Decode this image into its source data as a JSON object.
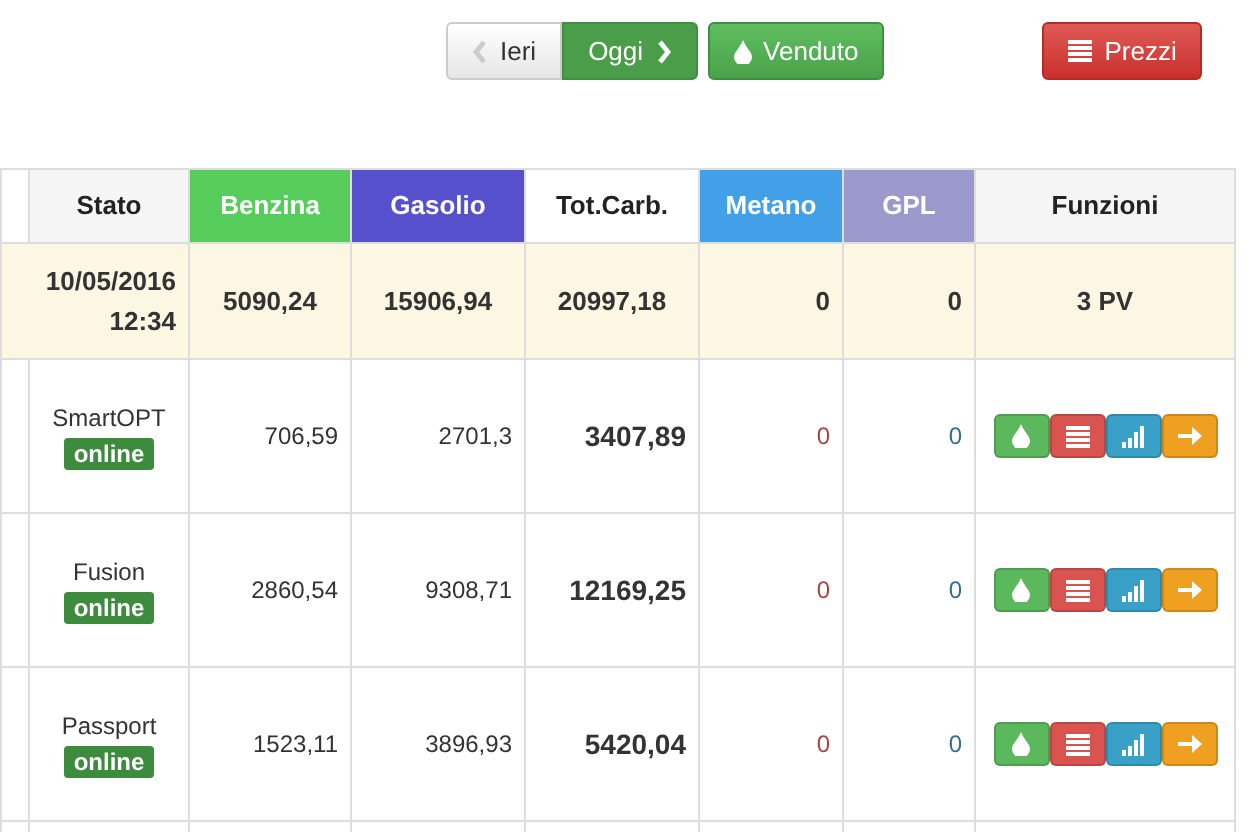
{
  "toolbar": {
    "day_buttons": [
      {
        "label": "Ieri",
        "selected": false,
        "kind": "prev"
      },
      {
        "label": "Oggi",
        "selected": true,
        "kind": "next"
      }
    ],
    "sold_button": "Venduto",
    "prices_button": "Prezzi"
  },
  "table": {
    "columns": [
      {
        "label": "Stato",
        "color": "#f5f5f5"
      },
      {
        "label": "Benzina",
        "color": "#56cc5a"
      },
      {
        "label": "Gasolio",
        "color": "#5650cc"
      },
      {
        "label": "Tot.Carb.",
        "color": "#ffffff"
      },
      {
        "label": "Metano",
        "color": "#42a0e8"
      },
      {
        "label": "GPL",
        "color": "#9b98cc"
      },
      {
        "label": "Funzioni",
        "color": "#f5f5f5"
      }
    ],
    "summary": {
      "timestamp": "10/05/2016 12:34",
      "benzina": "5090,24",
      "gasolio": "15906,94",
      "total": "20997,18",
      "metano": "0",
      "gpl": "0",
      "functions": "3 PV"
    },
    "row_actions": [
      {
        "kind": "drop"
      },
      {
        "kind": "list"
      },
      {
        "kind": "signal"
      },
      {
        "kind": "arrow"
      }
    ],
    "rows": [
      {
        "system": "SmartOPT",
        "status": "online",
        "benzina": "706,59",
        "gasolio": "2701,3",
        "total": "3407,89",
        "metano": "0",
        "gpl": "0"
      },
      {
        "system": "Fusion",
        "status": "online",
        "benzina": "2860,54",
        "gasolio": "9308,71",
        "total": "12169,25",
        "metano": "0",
        "gpl": "0"
      },
      {
        "system": "Passport",
        "status": "online",
        "benzina": "1523,11",
        "gasolio": "3896,93",
        "total": "5420,04",
        "metano": "0",
        "gpl": "0"
      }
    ]
  }
}
